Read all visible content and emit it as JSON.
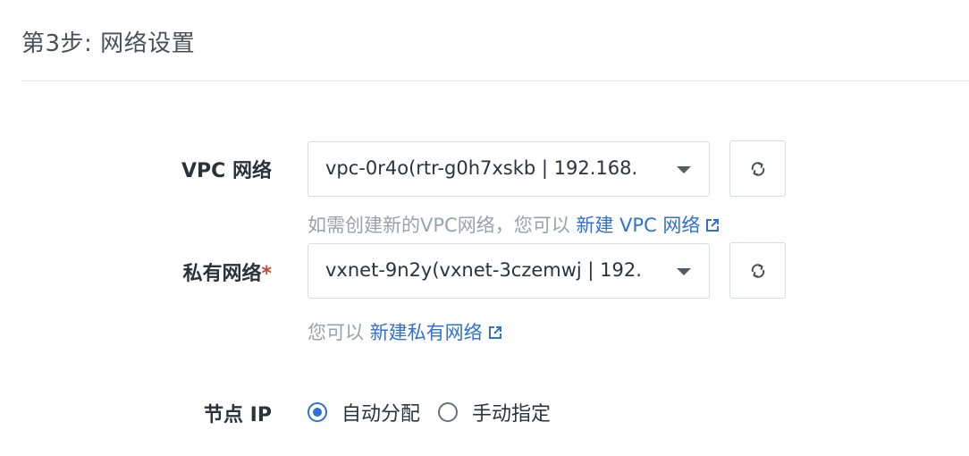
{
  "section": {
    "title": "第3步: 网络设置"
  },
  "vpc": {
    "label": "VPC 网络",
    "selected": "vpc-0r4o(rtr-g0h7xskb | 192.168.",
    "hint_prefix": "如需创建新的VPC网络，您可以 ",
    "hint_link": "新建 VPC 网络"
  },
  "private_net": {
    "label": "私有网络",
    "required_mark": "*",
    "selected": "vxnet-9n2y(vxnet-3czemwj | 192.",
    "hint_prefix": "您可以 ",
    "hint_link": "新建私有网络"
  },
  "node_ip": {
    "label": "节点 IP",
    "options": [
      {
        "label": "自动分配",
        "checked": true
      },
      {
        "label": "手动指定",
        "checked": false
      }
    ]
  },
  "colors": {
    "accent": "#2f6fd6",
    "required": "#c64433",
    "hint": "#9aa1ab",
    "border": "#d6dae2"
  },
  "icons": {
    "refresh": "refresh-icon",
    "external_link": "external-link-icon",
    "caret": "chevron-down-icon"
  }
}
